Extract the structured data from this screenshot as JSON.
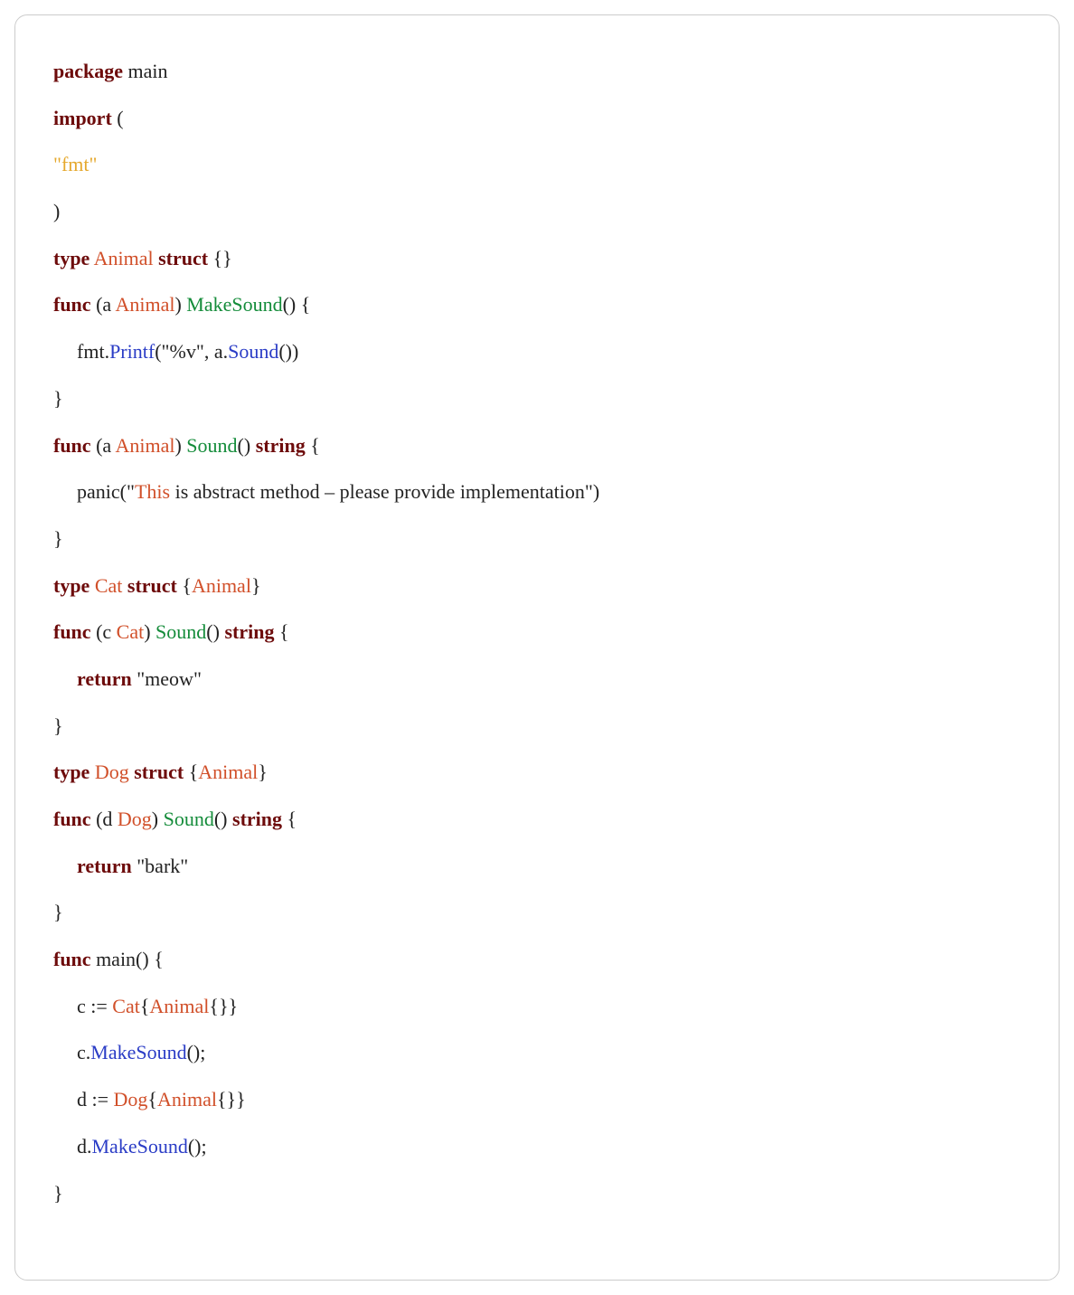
{
  "code": {
    "l1": {
      "kw_package": "package",
      "main": " main"
    },
    "l2": {
      "kw_import": "import",
      "open": " ("
    },
    "l3": {
      "fmt": "\"fmt\""
    },
    "l4": {
      "close": ")"
    },
    "l5": {
      "kw_type": "type",
      "sp1": " ",
      "name": "Animal",
      "sp2": " ",
      "kw_struct": "struct",
      "braces": " {}"
    },
    "l6": {
      "kw_func": "func",
      "recv_open": " (a ",
      "recv_type": "Animal",
      "recv_close": ") ",
      "fname": "MakeSound",
      "after": "() {"
    },
    "l7": {
      "fmt": "fmt",
      "dot": ".",
      "printf": "Printf",
      "open": "(",
      "str": "\"%v\"",
      "mid": ", a.",
      "sound": "Sound",
      "close": "())"
    },
    "l8": {
      "brace": "}"
    },
    "l9": {
      "kw_func": "func",
      "recv_open": " (a ",
      "recv_type": "Animal",
      "recv_close": ") ",
      "fname": "Sound",
      "parens": "() ",
      "ret": "string",
      "open": " {"
    },
    "l10": {
      "panic": "panic(",
      "q1": "\"",
      "this": "This",
      "rest": " is abstract method – please provide implementation\")"
    },
    "l11": {
      "brace": "}"
    },
    "l12": {
      "kw_type": "type",
      "sp1": " ",
      "name": "Cat",
      "sp2": " ",
      "kw_struct": "struct",
      "open": " {",
      "embed": "Animal",
      "close": "}"
    },
    "l13": {
      "kw_func": "func",
      "recv_open": " (c ",
      "recv_type": "Cat",
      "recv_close": ") ",
      "fname": "Sound",
      "parens": "() ",
      "ret": "string",
      "open": " {"
    },
    "l14": {
      "ret": "return",
      "sp": " ",
      "str": "\"meow\""
    },
    "l15": {
      "brace": "}"
    },
    "l16": {
      "kw_type": "type",
      "sp1": " ",
      "name": "Dog",
      "sp2": " ",
      "kw_struct": "struct",
      "open": " {",
      "embed": "Animal",
      "close": "}"
    },
    "l17": {
      "kw_func": "func",
      "recv_open": " (d ",
      "recv_type": "Dog",
      "recv_close": ") ",
      "fname": "Sound",
      "parens": "() ",
      "ret": "string",
      "open": " {"
    },
    "l18": {
      "ret": "return",
      "sp": " ",
      "str": "\"bark\""
    },
    "l19": {
      "brace": "}"
    },
    "l20": {
      "kw_func": "func",
      "main": " main() {"
    },
    "l21": {
      "c": "c := ",
      "cat": "Cat",
      "open": "{",
      "animal": "Animal",
      "close": "{}}"
    },
    "l22": {
      "c": "c.",
      "ms": "MakeSound",
      "after": "();"
    },
    "l23": {
      "d": "d := ",
      "dog": "Dog",
      "open": "{",
      "animal": "Animal",
      "close": "{}}"
    },
    "l24": {
      "d": "d.",
      "ms": "MakeSound",
      "after": "();"
    },
    "l25": {
      "brace": "}"
    }
  }
}
